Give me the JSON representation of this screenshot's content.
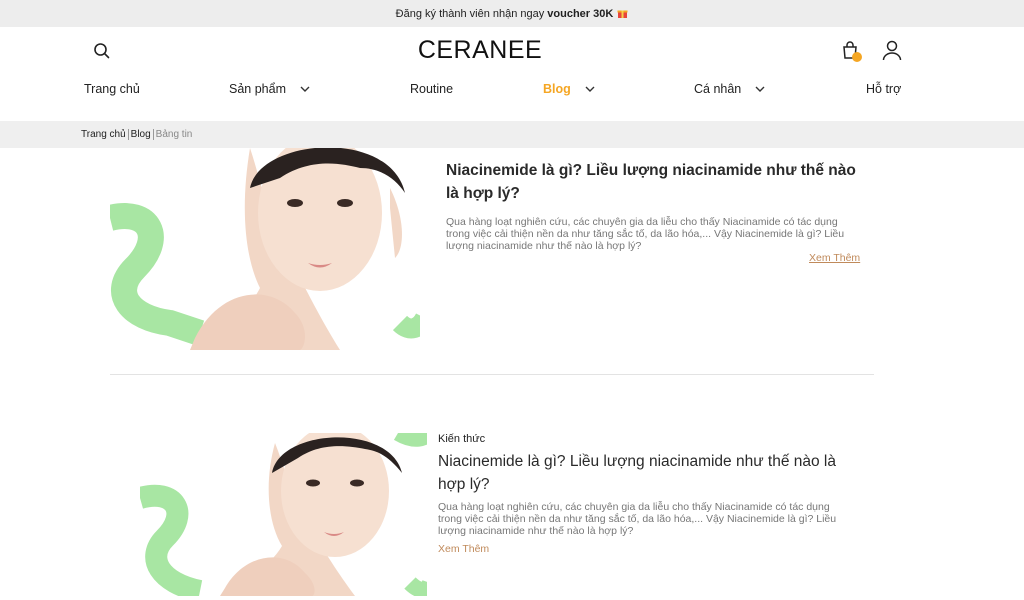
{
  "promo": {
    "text": "Đăng ký thành viên nhận ngay",
    "highlight": "voucher 30K",
    "icon": "gift-icon"
  },
  "header": {
    "logo": "CERANEE",
    "icons": [
      "search-icon",
      "shopping-bag-icon",
      "user-icon"
    ]
  },
  "nav": {
    "items": [
      {
        "label": "Trang chủ",
        "dropdown": false,
        "active": false
      },
      {
        "label": "Sản phẩm",
        "dropdown": true,
        "active": false
      },
      {
        "label": "Routine",
        "dropdown": false,
        "active": false
      },
      {
        "label": "Blog",
        "dropdown": true,
        "active": true
      },
      {
        "label": "Cá nhân",
        "dropdown": true,
        "active": false
      },
      {
        "label": "Hỗ trợ",
        "dropdown": false,
        "active": false
      }
    ]
  },
  "breadcrumb": [
    "Trang chủ",
    "Blog",
    "Bảng tin"
  ],
  "articles": [
    {
      "category": "",
      "title": "Niacinemide là gì? Liều lượng niacinamide như thế nào là hợp lý?",
      "excerpt": "Qua hàng loạt nghiên cứu, các chuyên gia da liễu cho thấy Niacinamide có tác dụng trong việc cải thiện nền da như tăng sắc tố, da lão hóa,... Vậy Niacinemide là gì? Liều lượng niacinamide như thế nào là hợp lý?",
      "more": "Xem Thêm"
    },
    {
      "category": "Kiến thức",
      "title": "Niacinemide là gì? Liều lượng niacinamide như thế nào là hợp lý?",
      "excerpt": "Qua hàng loạt nghiên cứu, các chuyên gia da liễu cho thấy Niacinamide có tác dụng trong việc cải thiện nền da như tăng sắc tố, da lão hóa,... Vậy Niacinemide là gì? Liều lượng niacinamide như thế nào là hợp lý?",
      "more": "Xem Thêm"
    }
  ],
  "colors": {
    "accent": "#f5a623",
    "link": "#c08a5b",
    "mint": "#a8e6a3",
    "promo_bg": "#ededed",
    "breadcrumb_bg": "#efefef"
  }
}
